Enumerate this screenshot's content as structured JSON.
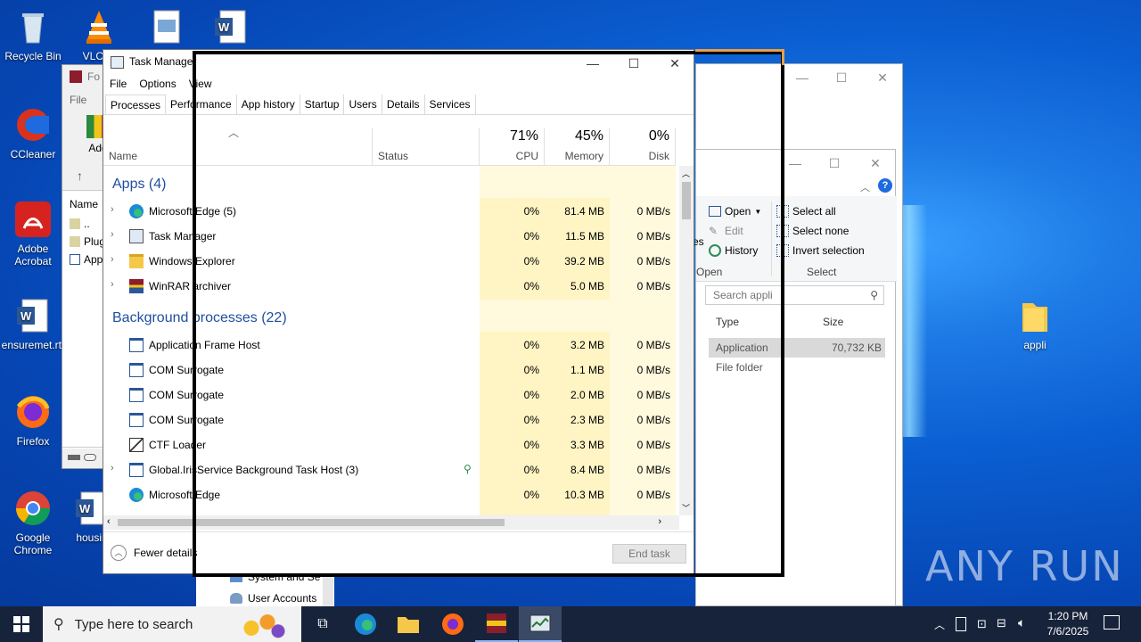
{
  "desktop": {
    "icons": [
      {
        "label": "Recycle Bin"
      },
      {
        "label": "VLC m"
      },
      {
        "label": "CCleaner"
      },
      {
        "label": "Adobe Acrobat"
      },
      {
        "label": "ensuremet.rtf"
      },
      {
        "label": "Firefox"
      },
      {
        "label": "Google Chrome"
      },
      {
        "label": "housin"
      },
      {
        "label": "appli"
      }
    ]
  },
  "back_window": {
    "title_partial": "Fo",
    "menu_file": "File",
    "add_label": "Add",
    "col_name": "Name",
    "items": [
      "..",
      "Plug",
      "App"
    ]
  },
  "explorer_window": {
    "ribbon": {
      "open": "Open",
      "edit": "Edit",
      "history": "History",
      "open_group": "Open",
      "select_all": "Select all",
      "select_none": "Select none",
      "invert_selection": "Invert selection",
      "select_group": "Select",
      "es_partial": "es"
    },
    "search_placeholder": "Search appli",
    "col_type": "Type",
    "col_size": "Size",
    "rows": [
      {
        "type": "Application",
        "size": "70,732 KB"
      },
      {
        "type": "File folder",
        "size": ""
      }
    ],
    "nav_items": [
      "System and Se",
      "User Accounts"
    ]
  },
  "task_manager": {
    "title": "Task Manager",
    "menu": [
      "File",
      "Options",
      "View"
    ],
    "tabs": [
      "Processes",
      "Performance",
      "App history",
      "Startup",
      "Users",
      "Details",
      "Services"
    ],
    "active_tab": "Processes",
    "headers": {
      "name": "Name",
      "status": "Status",
      "cpu_pct": "71%",
      "cpu": "CPU",
      "mem_pct": "45%",
      "mem": "Memory",
      "disk_pct": "0%",
      "disk": "Disk"
    },
    "apps_group": "Apps (4)",
    "apps": [
      {
        "name": "Microsoft Edge (5)",
        "cpu": "0%",
        "mem": "81.4 MB",
        "disk": "0 MB/s",
        "icon": "edge-icon"
      },
      {
        "name": "Task Manager",
        "cpu": "0%",
        "mem": "11.5 MB",
        "disk": "0 MB/s",
        "icon": "task-manager-icon"
      },
      {
        "name": "Windows Explorer",
        "cpu": "0%",
        "mem": "39.2 MB",
        "disk": "0 MB/s",
        "icon": "folder-icon"
      },
      {
        "name": "WinRAR archiver",
        "cpu": "0%",
        "mem": "5.0 MB",
        "disk": "0 MB/s",
        "icon": "winrar-icon"
      }
    ],
    "bg_group": "Background processes (22)",
    "bg": [
      {
        "name": "Application Frame Host",
        "cpu": "0%",
        "mem": "3.2 MB",
        "disk": "0 MB/s",
        "expand": false,
        "icon": "app-window-icon"
      },
      {
        "name": "COM Surrogate",
        "cpu": "0%",
        "mem": "1.1 MB",
        "disk": "0 MB/s",
        "expand": false,
        "icon": "app-window-icon"
      },
      {
        "name": "COM Surrogate",
        "cpu": "0%",
        "mem": "2.0 MB",
        "disk": "0 MB/s",
        "expand": false,
        "icon": "app-window-icon"
      },
      {
        "name": "COM Surrogate",
        "cpu": "0%",
        "mem": "2.3 MB",
        "disk": "0 MB/s",
        "expand": false,
        "icon": "app-window-icon"
      },
      {
        "name": "CTF Loader",
        "cpu": "0%",
        "mem": "3.3 MB",
        "disk": "0 MB/s",
        "expand": false,
        "icon": "ctf-loader-icon"
      },
      {
        "name": "Global.IrisService Background Task Host (3)",
        "cpu": "0%",
        "mem": "8.4 MB",
        "disk": "0 MB/s",
        "expand": true,
        "icon": "app-window-icon"
      },
      {
        "name": "Microsoft Edge",
        "cpu": "0%",
        "mem": "10.3 MB",
        "disk": "0 MB/s",
        "expand": false,
        "icon": "edge-icon"
      }
    ],
    "fewer_details": "Fewer details",
    "end_task": "End task"
  },
  "taskbar": {
    "search_placeholder": "Type here to search",
    "time": "1:20 PM",
    "date": "7/6/2025"
  },
  "watermark": "ANY RUN",
  "colors": {
    "accent_blue": "#1f4e9f",
    "heat_yellow": "#fff4c4",
    "taskbar": "#17233a"
  }
}
